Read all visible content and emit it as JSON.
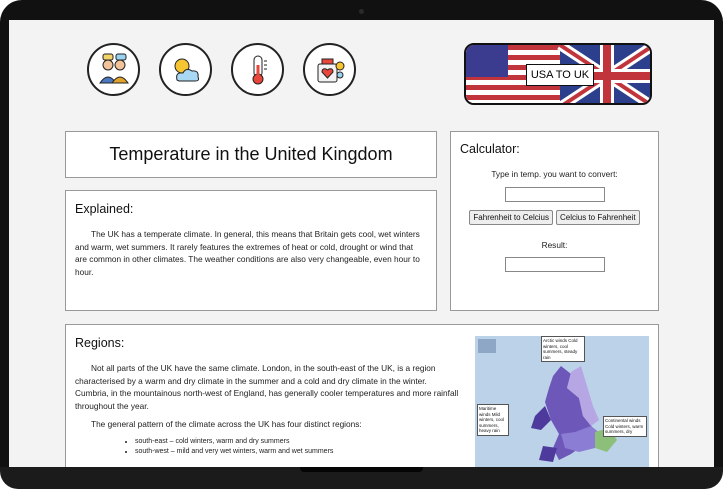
{
  "header": {
    "icons": [
      "people-icon",
      "weather-icon",
      "thermometer-icon",
      "health-kit-icon"
    ],
    "flag_label": "USA TO UK"
  },
  "title": "Temperature in the United Kingdom",
  "explained": {
    "heading": "Explained:",
    "text": "The UK has a temperate climate. In general, this means that Britain gets cool, wet winters and warm, wet summers. It rarely features the extremes of heat or cold, drought or wind that are common in other climates. The weather conditions are also very changeable, even hour to hour."
  },
  "calculator": {
    "heading": "Calculator:",
    "prompt": "Type in temp. you want to convert:",
    "btn_f_to_c": "Fahrenheit to Celcius",
    "btn_c_to_f": "Celcius to Fahrenheit",
    "result_label": "Result:"
  },
  "regions": {
    "heading": "Regions:",
    "p1": "Not all parts of the UK have the same climate. London, in the south-east of the UK, is a region characterised by a warm and dry climate in the summer and a cold and dry climate in the winter. Cumbria, in the mountainous north-west of England, has generally cooler temperatures and more rainfall throughout the year.",
    "p2": "The general pattern of the climate across the UK has four distinct regions:",
    "items": [
      "south-east – cold winters, warm and dry summers",
      "south-west – mild and very wet winters, warm and wet summers"
    ],
    "map_labels": [
      "Arctic winds Cold winters, cool summers, steady rain",
      "Maritime winds Mild winters, cool summers, heavy rain",
      "Continental winds Cold winters, warm summers, dry"
    ]
  }
}
